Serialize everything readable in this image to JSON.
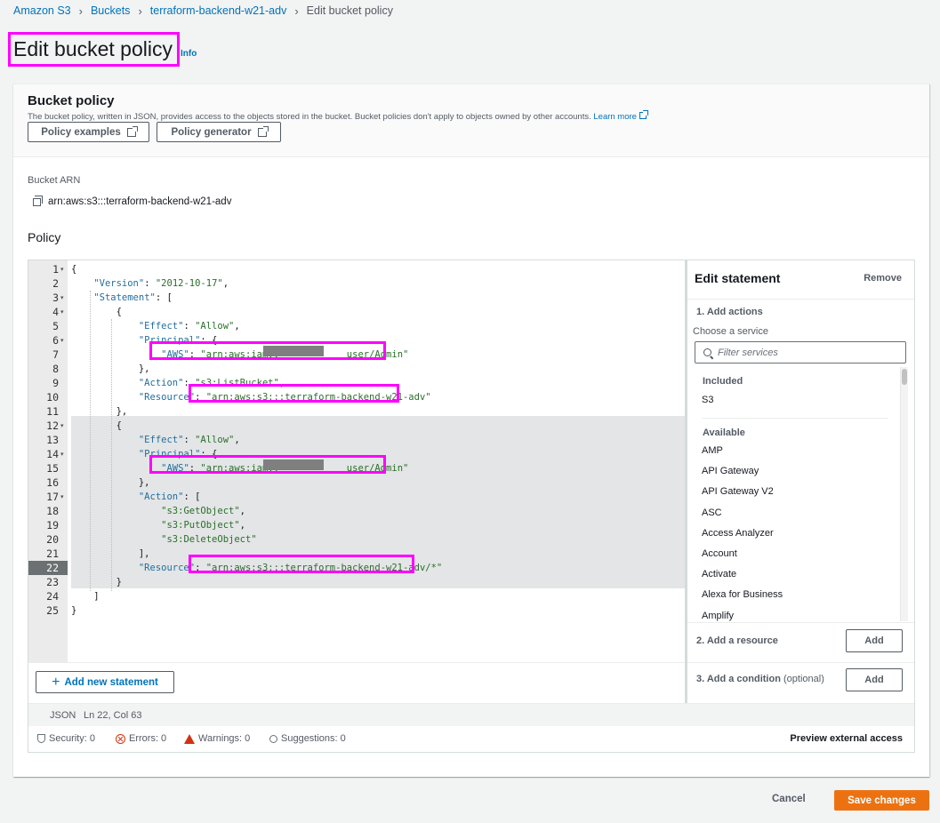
{
  "breadcrumb": [
    "Amazon S3",
    "Buckets",
    "terraform-backend-w21-adv",
    "Edit bucket policy"
  ],
  "page": {
    "title": "Edit bucket policy",
    "info": "Info"
  },
  "bucket_policy": {
    "heading": "Bucket policy",
    "description": "The bucket policy, written in JSON, provides access to the objects stored in the bucket. Bucket policies don't apply to objects owned by other accounts.",
    "learn_more": "Learn more",
    "examples_button": "Policy examples",
    "generator_button": "Policy generator"
  },
  "arn": {
    "label": "Bucket ARN",
    "value": "arn:aws:s3:::terraform-backend-w21-adv"
  },
  "policy_label": "Policy",
  "editor": {
    "lines": [
      [
        [
          "p",
          "{"
        ]
      ],
      [
        [
          "p",
          "    "
        ],
        [
          "k",
          "\"Version\""
        ],
        [
          "p",
          ": "
        ],
        [
          "s",
          "\"2012-10-17\""
        ],
        [
          "p",
          ","
        ]
      ],
      [
        [
          "p",
          "    "
        ],
        [
          "k",
          "\"Statement\""
        ],
        [
          "p",
          ": ["
        ]
      ],
      [
        [
          "p",
          "        {"
        ]
      ],
      [
        [
          "p",
          "            "
        ],
        [
          "k",
          "\"Effect\""
        ],
        [
          "p",
          ": "
        ],
        [
          "s",
          "\"Allow\""
        ],
        [
          "p",
          ","
        ]
      ],
      [
        [
          "p",
          "            "
        ],
        [
          "k",
          "\"Principal\""
        ],
        [
          "p",
          ": {"
        ]
      ],
      [
        [
          "p",
          "                "
        ],
        [
          "k",
          "\"AWS\""
        ],
        [
          "p",
          ": "
        ],
        [
          "s",
          "\"arn:aws:iam::"
        ],
        [
          "p",
          "            "
        ],
        [
          "s",
          "user/Admin\""
        ]
      ],
      [
        [
          "p",
          "            },"
        ]
      ],
      [
        [
          "p",
          "            "
        ],
        [
          "k",
          "\"Action\""
        ],
        [
          "p",
          ": "
        ],
        [
          "s",
          "\"s3:ListBucket\""
        ],
        [
          "p",
          ","
        ]
      ],
      [
        [
          "p",
          "            "
        ],
        [
          "k",
          "\"Resource\""
        ],
        [
          "p",
          ": "
        ],
        [
          "s",
          "\"arn:aws:s3:::terraform-backend-w21-adv\""
        ]
      ],
      [
        [
          "p",
          "        },"
        ]
      ],
      [
        [
          "p",
          "        {"
        ]
      ],
      [
        [
          "p",
          "            "
        ],
        [
          "k",
          "\"Effect\""
        ],
        [
          "p",
          ": "
        ],
        [
          "s",
          "\"Allow\""
        ],
        [
          "p",
          ","
        ]
      ],
      [
        [
          "p",
          "            "
        ],
        [
          "k",
          "\"Principal\""
        ],
        [
          "p",
          ": {"
        ]
      ],
      [
        [
          "p",
          "                "
        ],
        [
          "k",
          "\"AWS\""
        ],
        [
          "p",
          ": "
        ],
        [
          "s",
          "\"arn:aws:iam::"
        ],
        [
          "p",
          "            "
        ],
        [
          "s",
          "user/Admin\""
        ]
      ],
      [
        [
          "p",
          "            },"
        ]
      ],
      [
        [
          "p",
          "            "
        ],
        [
          "k",
          "\"Action\""
        ],
        [
          "p",
          ": ["
        ]
      ],
      [
        [
          "p",
          "                "
        ],
        [
          "s",
          "\"s3:GetObject\""
        ],
        [
          "p",
          ","
        ]
      ],
      [
        [
          "p",
          "                "
        ],
        [
          "s",
          "\"s3:PutObject\""
        ],
        [
          "p",
          ","
        ]
      ],
      [
        [
          "p",
          "                "
        ],
        [
          "s",
          "\"s3:DeleteObject\""
        ]
      ],
      [
        [
          "p",
          "            ],"
        ]
      ],
      [
        [
          "p",
          "            "
        ],
        [
          "k",
          "\"Resource\""
        ],
        [
          "p",
          ": "
        ],
        [
          "s",
          "\"arn:aws:s3:::terraform-backend-w21-adv/*\""
        ]
      ],
      [
        [
          "p",
          "        }"
        ]
      ],
      [
        [
          "p",
          "    ]"
        ]
      ],
      [
        [
          "p",
          "}"
        ]
      ]
    ],
    "active_line": 22,
    "add_statement": "Add new statement",
    "mode": "JSON",
    "cursor": "Ln 22, Col 63"
  },
  "edit_statement": {
    "title": "Edit statement",
    "remove": "Remove",
    "step1": "1. Add actions",
    "choose_service": "Choose a service",
    "filter_placeholder": "Filter services",
    "included_label": "Included",
    "included": [
      "S3"
    ],
    "available_label": "Available",
    "available": [
      "AMP",
      "API Gateway",
      "API Gateway V2",
      "ASC",
      "Access Analyzer",
      "Account",
      "Activate",
      "Alexa for Business",
      "Amplify"
    ],
    "step2": "2. Add a resource",
    "step3": "3. Add a condition",
    "step3_optional": "(optional)",
    "add": "Add"
  },
  "validation": {
    "security": "Security: 0",
    "errors": "Errors: 0",
    "warnings": "Warnings: 0",
    "suggestions": "Suggestions: 0",
    "preview": "Preview external access"
  },
  "footer": {
    "cancel": "Cancel",
    "save": "Save changes"
  },
  "colors": {
    "accent": "#0073bb",
    "save": "#ec7211",
    "highlight": "#ff00ff"
  }
}
